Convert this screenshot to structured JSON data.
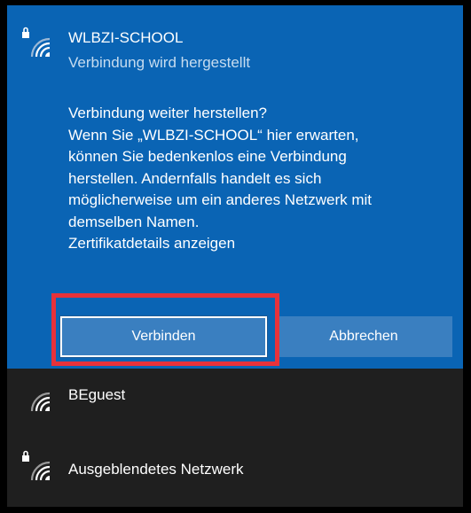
{
  "colors": {
    "accent": "#0a64b4",
    "panel_background": "#1f1f1f",
    "button": "#3a7fc0",
    "annotation_highlight": "#e8323a"
  },
  "selected_network": {
    "name": "WLBZI-SCHOOL",
    "status": "Verbindung wird hergestellt",
    "icon": "wifi-secured-icon",
    "message_lines": [
      "Verbindung weiter herstellen?",
      "Wenn Sie „WLBZI-SCHOOL“ hier erwarten,",
      "können Sie bedenkenlos eine Verbindung",
      "herstellen. Andernfalls handelt es sich",
      "möglicherweise um ein anderes Netzwerk mit",
      "demselben Namen."
    ],
    "details_link": "Zertifikatdetails anzeigen",
    "connect_button": "Verbinden",
    "cancel_button": "Abbrechen"
  },
  "networks": [
    {
      "name": "BEguest",
      "icon": "wifi-icon",
      "secured": false
    },
    {
      "name": "Ausgeblendetes Netzwerk",
      "icon": "wifi-secured-icon",
      "secured": true
    }
  ]
}
